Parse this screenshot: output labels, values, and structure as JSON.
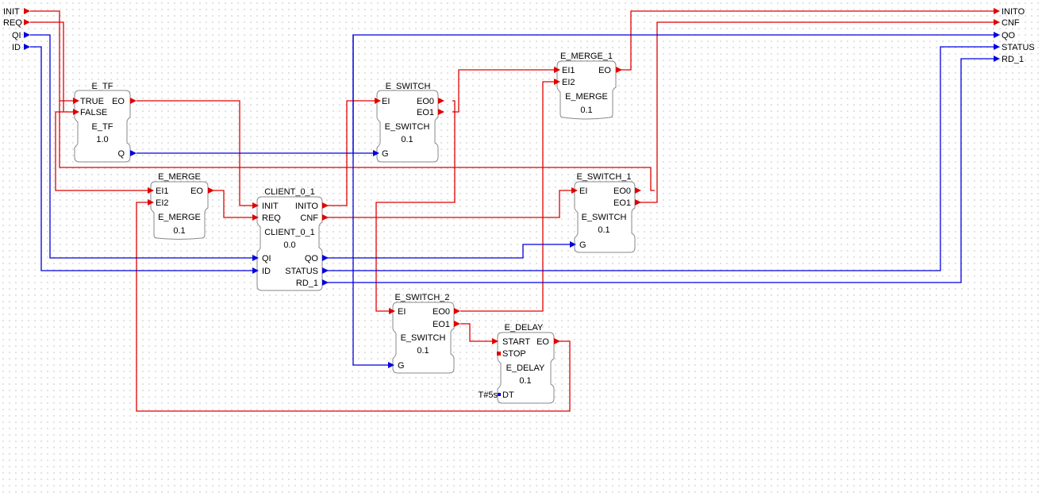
{
  "interface": {
    "inputs": [
      {
        "id": "INIT",
        "kind": "event"
      },
      {
        "id": "REQ",
        "kind": "event"
      },
      {
        "id": "QI",
        "kind": "data"
      },
      {
        "id": "ID",
        "kind": "data"
      }
    ],
    "outputs": [
      {
        "id": "INITO",
        "kind": "event"
      },
      {
        "id": "CNF",
        "kind": "event"
      },
      {
        "id": "QO",
        "kind": "data"
      },
      {
        "id": "STATUS",
        "kind": "data"
      },
      {
        "id": "RD_1",
        "kind": "data"
      }
    ]
  },
  "blocks": {
    "e_tf": {
      "instance": "E_TF",
      "type": "E_TF",
      "version": "1.0",
      "ports": {
        "in_true": "TRUE",
        "in_false": "FALSE",
        "out_eo": "EO",
        "out_q": "Q"
      }
    },
    "e_merge": {
      "instance": "E_MERGE",
      "type": "E_MERGE",
      "version": "0.1",
      "ports": {
        "in_ei1": "EI1",
        "in_ei2": "EI2",
        "out_eo": "EO"
      }
    },
    "client": {
      "instance": "CLIENT_0_1",
      "type": "CLIENT_0_1",
      "version": "0.0",
      "ports": {
        "in_init": "INIT",
        "in_req": "REQ",
        "in_qi": "QI",
        "in_id": "ID",
        "out_inito": "INITO",
        "out_cnf": "CNF",
        "out_qo": "QO",
        "out_status": "STATUS",
        "out_rd1": "RD_1"
      }
    },
    "e_switch": {
      "instance": "E_SWITCH",
      "type": "E_SWITCH",
      "version": "0.1",
      "ports": {
        "in_ei": "EI",
        "in_g": "G",
        "out_eo0": "EO0",
        "out_eo1": "EO1"
      }
    },
    "e_merge_1": {
      "instance": "E_MERGE_1",
      "type": "E_MERGE",
      "version": "0.1",
      "ports": {
        "in_ei1": "EI1",
        "in_ei2": "EI2",
        "out_eo": "EO"
      }
    },
    "e_switch_1": {
      "instance": "E_SWITCH_1",
      "type": "E_SWITCH",
      "version": "0.1",
      "ports": {
        "in_ei": "EI",
        "in_g": "G",
        "out_eo0": "EO0",
        "out_eo1": "EO1"
      }
    },
    "e_switch_2": {
      "instance": "E_SWITCH_2",
      "type": "E_SWITCH",
      "version": "0.1",
      "ports": {
        "in_ei": "EI",
        "in_g": "G",
        "out_eo0": "EO0",
        "out_eo1": "EO1"
      }
    },
    "e_delay": {
      "instance": "E_DELAY",
      "type": "E_DELAY",
      "version": "0.1",
      "ports": {
        "in_start": "START",
        "in_stop": "STOP",
        "in_dt": "DT",
        "out_eo": "EO"
      },
      "dt_value": "T#5s"
    }
  },
  "colors": {
    "event": "#e00000",
    "data": "#0000e0",
    "block_border": "#888888",
    "grid_dot": "#c8c8c8"
  }
}
